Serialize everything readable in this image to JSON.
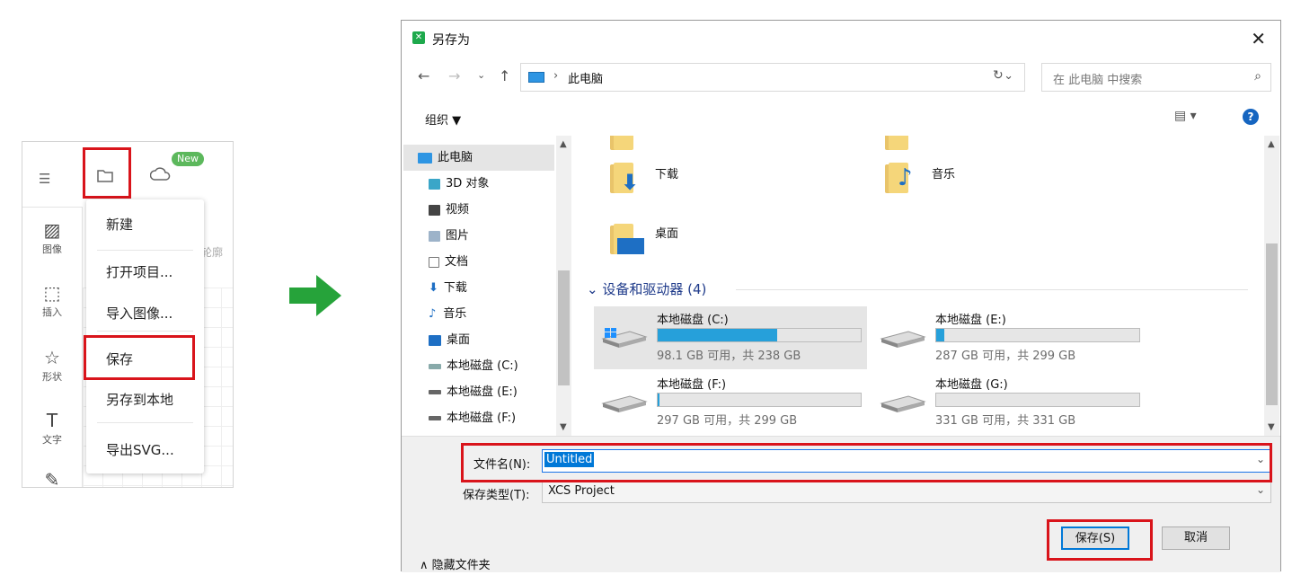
{
  "left_app": {
    "new_badge": "New",
    "sidebar": [
      {
        "label": "图像",
        "icon": "image-icon"
      },
      {
        "label": "插入",
        "icon": "insert-icon"
      },
      {
        "label": "形状",
        "icon": "shape-icon"
      },
      {
        "label": "文字",
        "icon": "text-icon"
      }
    ],
    "toolbar_partial": "轮廓",
    "menu": [
      "新建",
      "打开项目...",
      "导入图像...",
      "保存",
      "另存到本地",
      "导出SVG..."
    ]
  },
  "dialog": {
    "title": "另存为",
    "address_path": "此电脑",
    "search_placeholder": "在 此电脑 中搜索",
    "organize": "组织 ▼",
    "tree": [
      "此电脑",
      "3D 对象",
      "视频",
      "图片",
      "文档",
      "下载",
      "音乐",
      "桌面",
      "本地磁盘 (C:)",
      "本地磁盘 (E:)",
      "本地磁盘 (F:)"
    ],
    "folders": [
      "下载",
      "音乐",
      "桌面"
    ],
    "group_header": "设备和驱动器 (4)",
    "drives": [
      {
        "name": "本地磁盘 (C:)",
        "free": "98.1 GB 可用，共 238 GB",
        "used_fraction": 0.59
      },
      {
        "name": "本地磁盘 (E:)",
        "free": "287 GB 可用，共 299 GB",
        "used_fraction": 0.04
      },
      {
        "name": "本地磁盘 (F:)",
        "free": "297 GB 可用，共 299 GB",
        "used_fraction": 0.01
      },
      {
        "name": "本地磁盘 (G:)",
        "free": "331 GB 可用，共 331 GB",
        "used_fraction": 0.0
      }
    ],
    "filename_label": "文件名(N):",
    "filename_value": "Untitled",
    "filetype_label": "保存类型(T):",
    "filetype_value": "XCS Project",
    "hide_folders": "隐藏文件夹",
    "save_button": "保存(S)",
    "cancel_button": "取消"
  },
  "colors": {
    "highlight": "#d9141b",
    "arrow": "#26a33a",
    "drive_fill": "#26a0da",
    "selection": "#0078d7"
  }
}
